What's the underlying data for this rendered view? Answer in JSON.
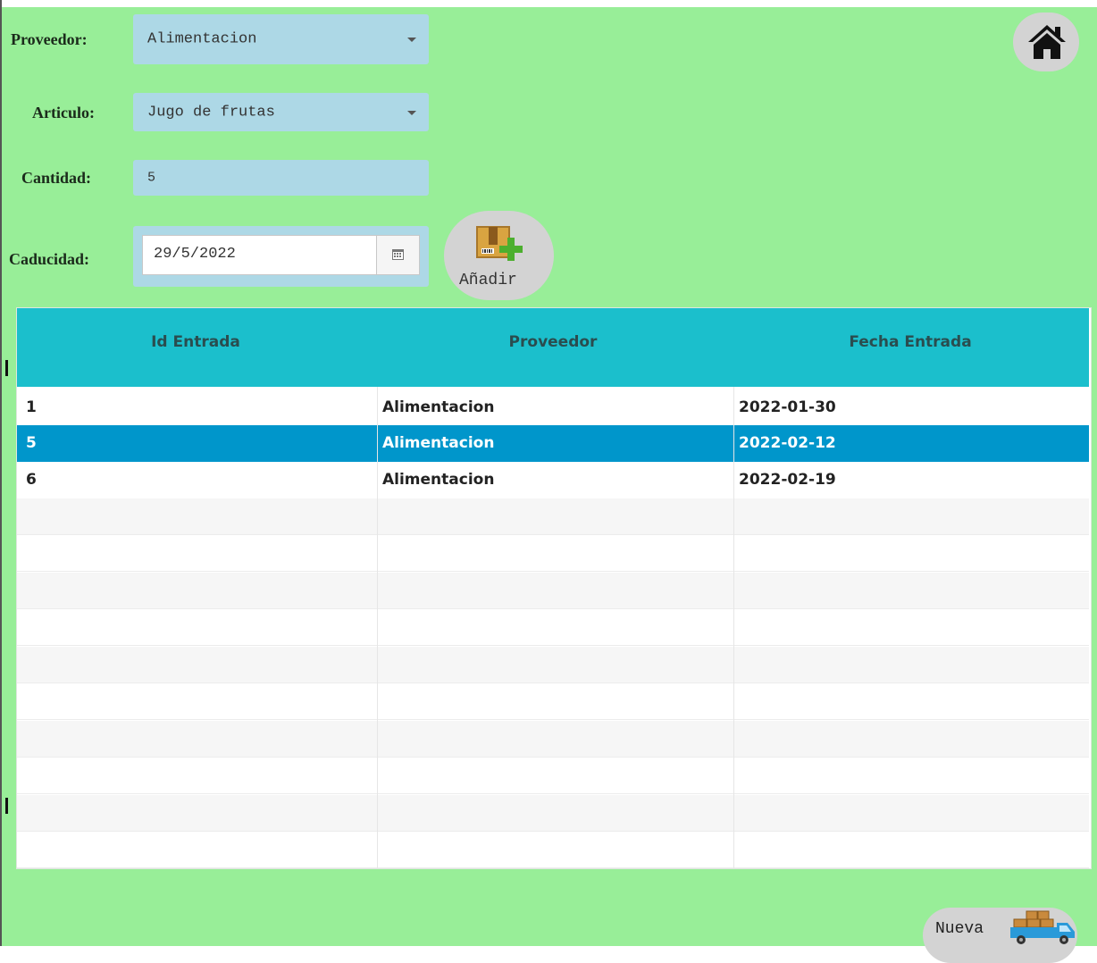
{
  "form": {
    "proveedor": {
      "label": "Proveedor:",
      "value": "Alimentacion"
    },
    "articulo": {
      "label": "Articulo:",
      "value": "Jugo de frutas"
    },
    "cantidad": {
      "label": "Cantidad:",
      "value": "5"
    },
    "caducidad": {
      "label": "Caducidad:",
      "value": "29/5/2022"
    }
  },
  "buttons": {
    "add_label": "Añadir",
    "new_label": "Nueva",
    "home_icon": "home-icon",
    "add_icon": "box-add-icon",
    "new_icon": "delivery-truck-icon",
    "calendar_icon": "calendar-icon"
  },
  "table": {
    "columns": [
      "Id Entrada",
      "Proveedor",
      "Fecha Entrada"
    ],
    "rows": [
      [
        "1",
        "Alimentacion",
        "2022-01-30"
      ],
      [
        "5",
        "Alimentacion",
        "2022-02-12"
      ],
      [
        "6",
        "Alimentacion",
        "2022-02-19"
      ]
    ],
    "selected_row_index": 1
  },
  "colors": {
    "background": "#98ee98",
    "field": "#add8e6",
    "header": "#1bbfcc",
    "selected_row": "#0096cb",
    "round_button": "#d3d3d3"
  }
}
